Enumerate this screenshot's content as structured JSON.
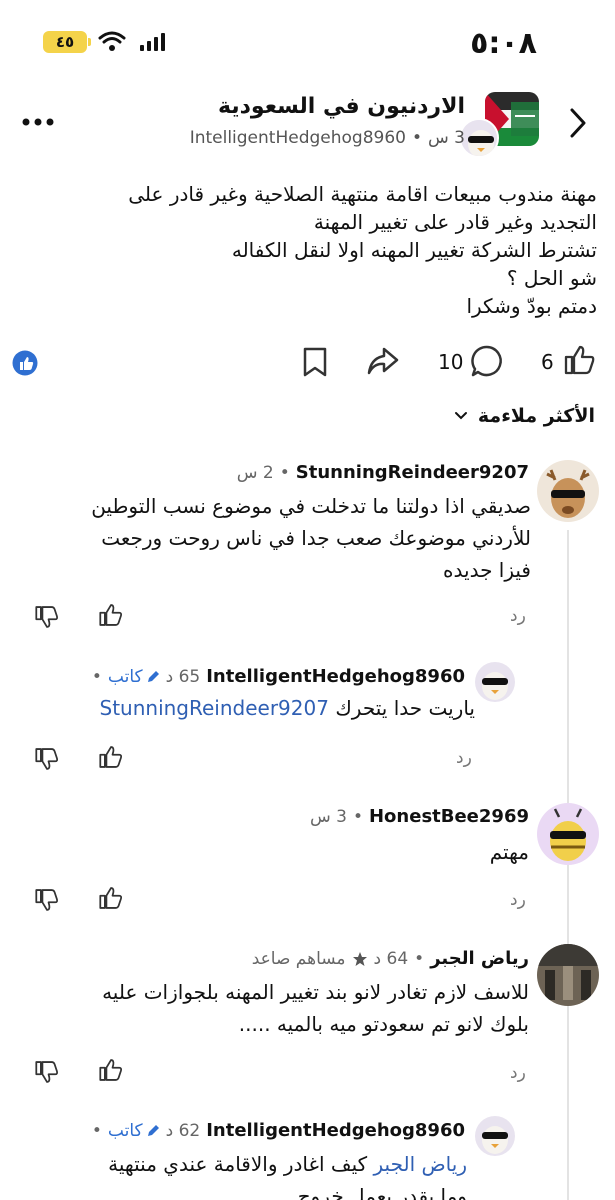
{
  "status_bar": {
    "time": "٥:٠٨",
    "battery": "٤٥"
  },
  "header": {
    "community": "الاردنيون في السعودية",
    "time_ago": "3 س",
    "username": "IntelligentHedgehog8960"
  },
  "post": {
    "lines": [
      "مهنة مندوب مبيعات اقامة منتهية الصلاحية وغير قادر على",
      "التجديد وغير قادر على تغيير المهنة",
      "تشترط الشركة تغيير المهنه اولا لنقل الكفاله",
      "شو الحل ؟",
      "دمتم بودّ وشكرا"
    ],
    "upvotes": "6",
    "comments": "10"
  },
  "sort": {
    "label": "الأكثر ملاءمة"
  },
  "comments": [
    {
      "name": "StunningReindeer9207",
      "time": "2 س",
      "lines": [
        "صديقي اذا دولتنا ما تدخلت في موضوع نسب التوطين",
        "للأردني موضوعك صعب جدا في ناس روحت ورجعت",
        "فيزا جديده"
      ],
      "reply": "رد"
    },
    {
      "name": "IntelligentHedgehog8960",
      "time": "65 د",
      "badge": "كاتب",
      "mention": "StunningReindeer9207",
      "text": "ياريت حدا يتحرك",
      "reply": "رد"
    },
    {
      "name": "HonestBee2969",
      "time": "3 س",
      "text": "مهتم",
      "reply": "رد"
    },
    {
      "name": "رياض الجبر",
      "time": "64 د",
      "badge": "مساهم صاعد",
      "lines": [
        "للاسف لازم تغادر لانو بند تغيير المهنه بلجوازات عليه",
        "بلوك لانو  تم سعودتو ميه بالميه ....."
      ],
      "reply": "رد"
    },
    {
      "name": "IntelligentHedgehog8960",
      "time": "62 د",
      "badge": "كاتب",
      "mention": "رياض الجبر",
      "text": "كيف اغادر والاقامة عندي منتهية",
      "text2": "وما بقدر بعمل خروج"
    }
  ],
  "colors": {
    "accent": "#2f6fd1",
    "battery": "#f4d34a",
    "mention": "#2f5fb3"
  }
}
